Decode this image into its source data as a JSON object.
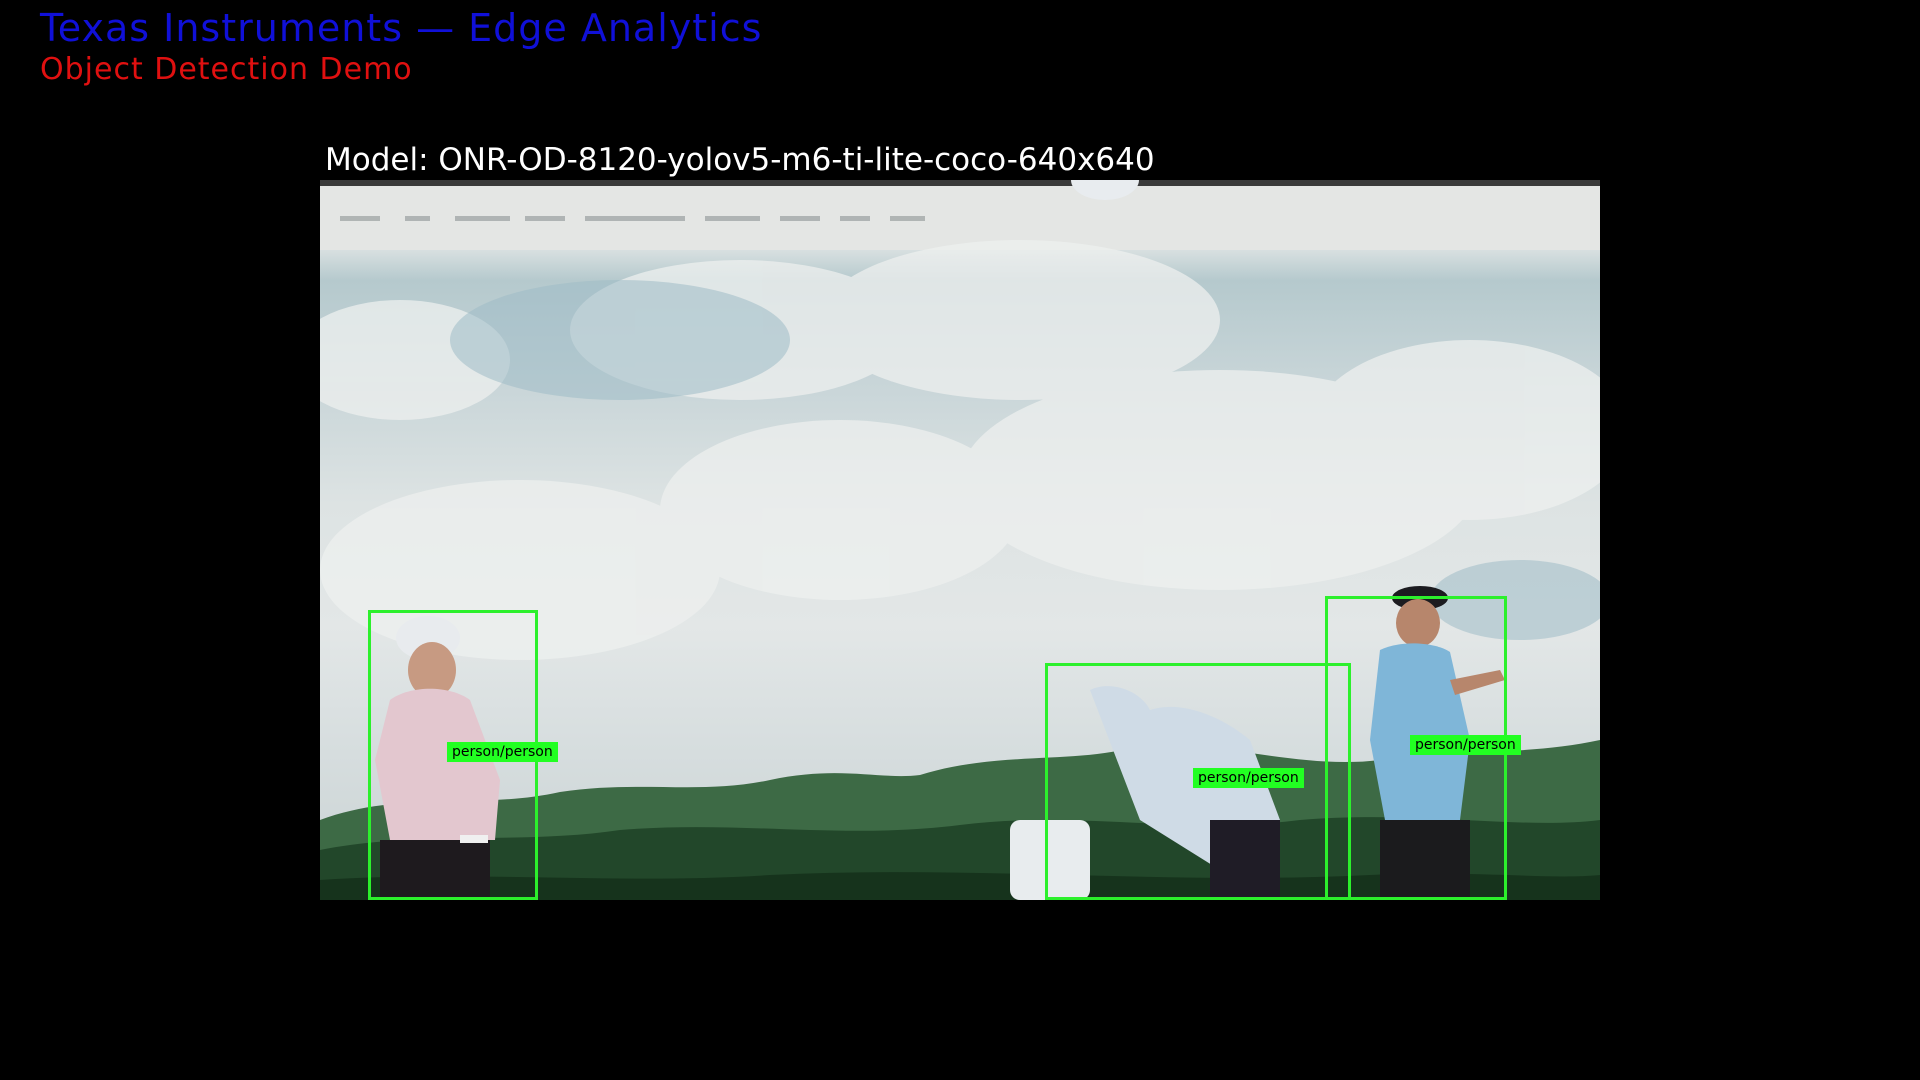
{
  "header": {
    "title": "Texas Instruments — Edge Analytics",
    "title_color": "#1010d8",
    "subtitle": "Object Detection Demo",
    "subtitle_color": "#e01010"
  },
  "model": {
    "label": "Model: ONR-OD-8120-yolov5-m6-ti-lite-coco-640x640"
  },
  "video": {
    "scene": "camera view of a monitor showing golfers on a hill with mountains",
    "detections": [
      {
        "label": "person/person",
        "class": "person"
      },
      {
        "label": "person/person",
        "class": "person"
      },
      {
        "label": "person/person",
        "class": "person"
      }
    ],
    "box_color": "#2cf02c"
  }
}
